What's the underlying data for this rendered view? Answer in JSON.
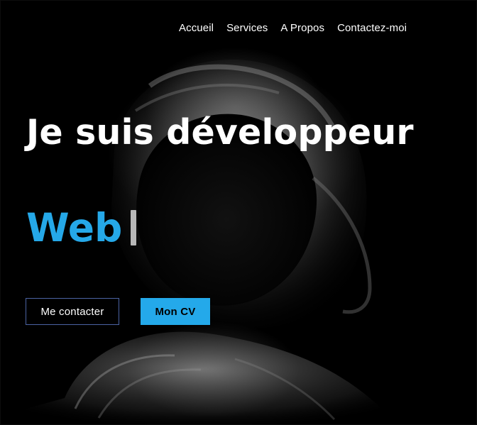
{
  "nav": {
    "items": [
      {
        "label": "Accueil"
      },
      {
        "label": "Services"
      },
      {
        "label": "A Propos"
      },
      {
        "label": "Contactez-moi"
      }
    ]
  },
  "hero": {
    "headline": "Je suis développeur",
    "typed_word": "Web",
    "accent_color": "#25a8e8",
    "background_image": "hooded-figure-dark-photo"
  },
  "buttons": {
    "contact_label": "Me contacter",
    "cv_label": "Mon CV"
  }
}
